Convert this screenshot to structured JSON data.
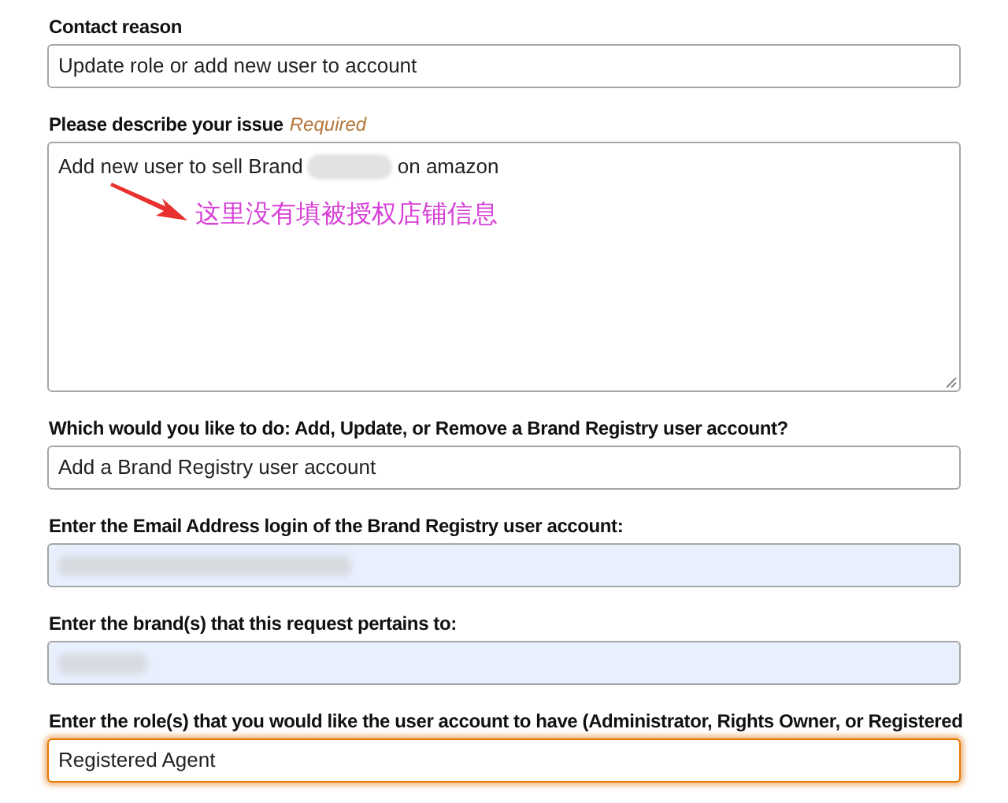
{
  "fields": [
    {
      "kind": "input",
      "label": "Contact reason",
      "value": "Update role or add new user to account",
      "autofilled": false,
      "focused": false,
      "redacted": false
    },
    {
      "kind": "textarea",
      "label": "Please describe your issue",
      "required_note": "Required",
      "value_before": "Add new user to sell Brand",
      "value_after": "on amazon",
      "autofilled": false,
      "focused": false,
      "annotation": {
        "text": "这里没有填被授权店铺信息",
        "color": "#d63fd6"
      }
    },
    {
      "kind": "input",
      "label": "Which would you like to do: Add, Update, or Remove a Brand Registry user account?",
      "value": "Add a Brand Registry user account",
      "autofilled": false,
      "focused": false,
      "redacted": false
    },
    {
      "kind": "input",
      "label": "Enter the Email Address login of the Brand Registry user account:",
      "autofilled": true,
      "focused": false,
      "redacted": true
    },
    {
      "kind": "input",
      "label": "Enter the brand(s) that this request pertains to:",
      "autofilled": true,
      "focused": false,
      "redacted": true
    },
    {
      "kind": "input",
      "label": "Enter the role(s) that you would like the user account to have (Administrator, Rights Owner, or Registered",
      "value": "Registered Agent",
      "autofilled": false,
      "focused": true,
      "redacted": false
    }
  ]
}
